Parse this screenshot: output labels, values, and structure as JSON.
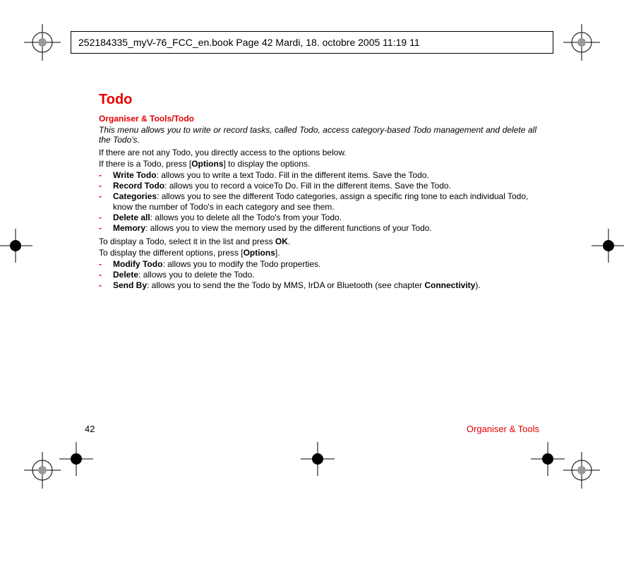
{
  "header": {
    "text": "252184335_myV-76_FCC_en.book  Page 42  Mardi, 18. octobre 2005  11:19 11"
  },
  "title": "Todo",
  "breadcrumb": "Organiser & Tools/Todo",
  "intro": "This menu allows you to write or record tasks, called Todo, access category-based Todo management and delete all the Todo's.",
  "para1": "If there are not any Todo, you directly access to the options below.",
  "para2_pre": "If there is a Todo, press [",
  "para2_b": "Options",
  "para2_post": "] to display the options.",
  "list1": [
    {
      "term": "Write Todo",
      "desc": ": allows you to write a text Todo. Fill in the different items. Save the Todo."
    },
    {
      "term": "Record Todo",
      "desc": ": allows you to record a voiceTo Do. Fill in the different items. Save the Todo."
    },
    {
      "term": "Categories",
      "desc": ": allows you to see the different Todo categories, assign a specific ring tone to each individual Todo, know the number of Todo's in each category and see them."
    },
    {
      "term": "Delete all",
      "desc": ": allows you to delete all the Todo's from your Todo."
    },
    {
      "term": "Memory",
      "desc": ": allows you to view the memory used by the different functions of your Todo."
    }
  ],
  "para3_pre": "To display a Todo, select it in the list and press ",
  "para3_b": "OK",
  "para3_post": ".",
  "para4_pre": "To display the different options, press [",
  "para4_b": "Options",
  "para4_post": "].",
  "list2": [
    {
      "term": "Modify Todo",
      "desc": ": allows you to modify the Todo properties."
    },
    {
      "term": "Delete",
      "desc": ": allows you to delete the Todo."
    },
    {
      "term": "Send By",
      "desc_pre": ": allows you to send the the Todo by MMS, IrDA or Bluetooth (see chapter ",
      "desc_b": "Connectivity",
      "desc_post": ")."
    }
  ],
  "footer": {
    "page": "42",
    "section": "Organiser & Tools"
  }
}
